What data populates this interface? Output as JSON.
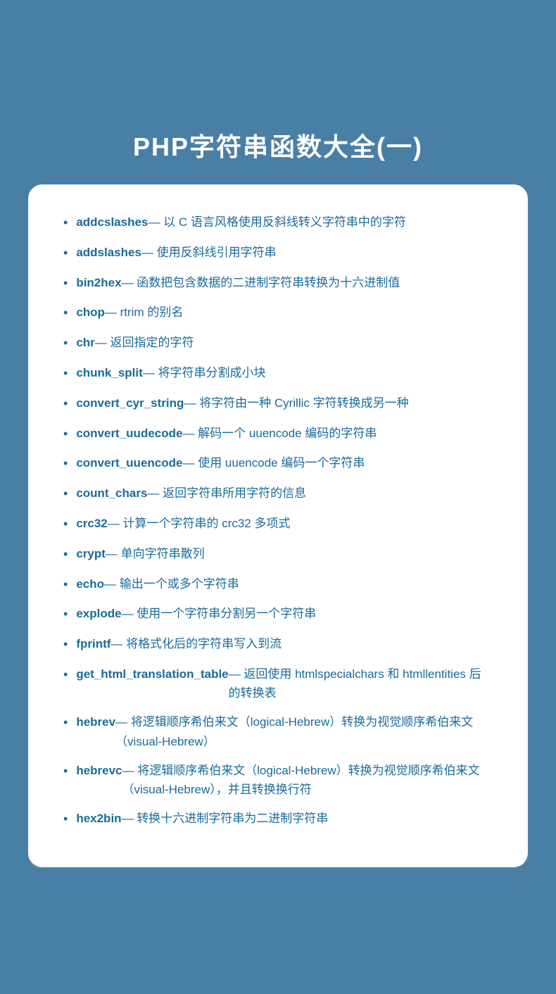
{
  "page": {
    "title": "PHP字符串函数大全(一)",
    "background_color": "#4a7fa5",
    "card_background": "#ffffff"
  },
  "functions": [
    {
      "name": "addcslashes",
      "desc": "— 以 C 语言风格使用反斜线转义字符串中的字符"
    },
    {
      "name": "addslashes",
      "desc": "— 使用反斜线引用字符串"
    },
    {
      "name": "bin2hex",
      "desc": "— 函数把包含数据的二进制字符串转换为十六进制值"
    },
    {
      "name": "chop",
      "desc": "— rtrim 的别名"
    },
    {
      "name": "chr",
      "desc": "— 返回指定的字符"
    },
    {
      "name": "chunk_split",
      "desc": "— 将字符串分割成小块"
    },
    {
      "name": "convert_cyr_string",
      "desc": "— 将字符由一种 Cyrillic 字符转换成另一种"
    },
    {
      "name": "convert_uudecode",
      "desc": "— 解码一个 uuencode 编码的字符串"
    },
    {
      "name": "convert_uuencode",
      "desc": "— 使用 uuencode 编码一个字符串"
    },
    {
      "name": "count_chars",
      "desc": "— 返回字符串所用字符的信息"
    },
    {
      "name": "crc32",
      "desc": "— 计算一个字符串的 crc32 多项式"
    },
    {
      "name": "crypt",
      "desc": "— 单向字符串散列"
    },
    {
      "name": "echo",
      "desc": "— 输出一个或多个字符串"
    },
    {
      "name": "explode",
      "desc": "— 使用一个字符串分割另一个字符串"
    },
    {
      "name": "fprintf",
      "desc": "— 将格式化后的字符串写入到流"
    },
    {
      "name": "get_html_translation_table",
      "desc": "— 返回使用 htmlspecialchars 和 htmllentities 后的转换表"
    },
    {
      "name": "hebrev",
      "desc": "— 将逻辑顺序希伯来文（logical-Hebrew）转换为视觉顺序希伯来文（visual-Hebrew）"
    },
    {
      "name": "hebrevc",
      "desc": "— 将逻辑顺序希伯来文（logical-Hebrew）转换为视觉顺序希伯来文（visual-Hebrew），并且转换换行符"
    },
    {
      "name": "hex2bin",
      "desc": "— 转换十六进制字符串为二进制字符串"
    }
  ]
}
